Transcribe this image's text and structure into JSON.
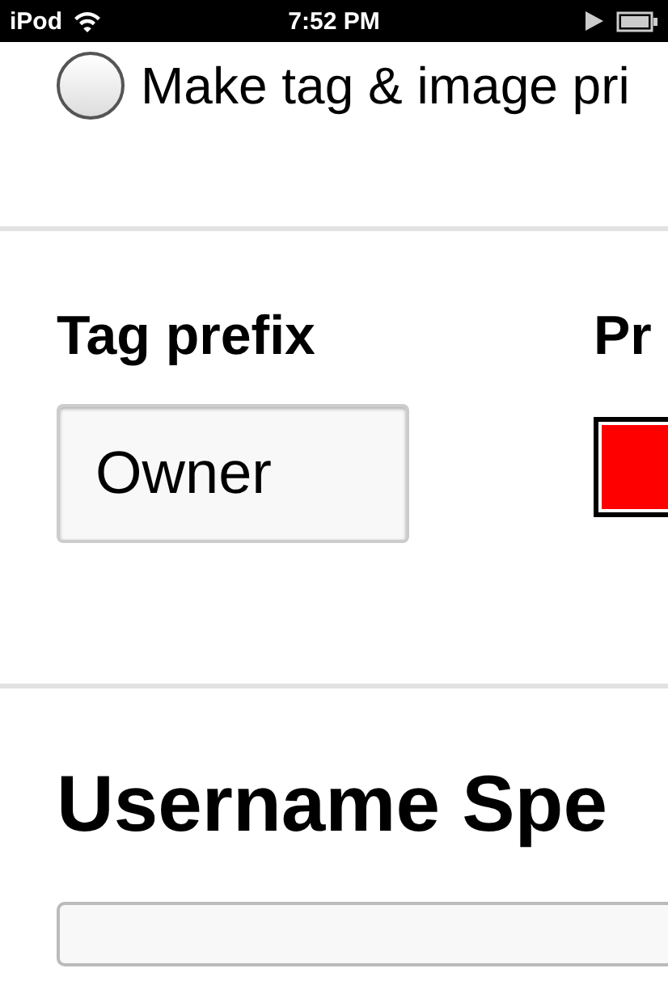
{
  "status_bar": {
    "carrier": "iPod",
    "time": "7:52 PM"
  },
  "radio": {
    "label": "Make tag & image pri",
    "selected": false
  },
  "tag_prefix": {
    "label": "Tag prefix",
    "value": "Owner"
  },
  "second_column": {
    "label": "Pr"
  },
  "username_section": {
    "heading": "Username Spe"
  }
}
